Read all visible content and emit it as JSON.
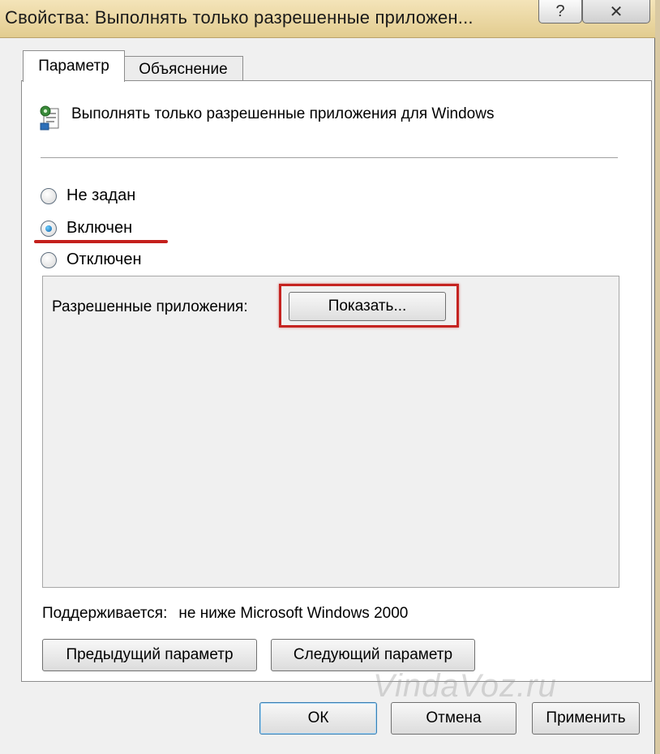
{
  "window": {
    "title": "Свойства: Выполнять только разрешенные приложен..."
  },
  "titlebar": {
    "help_label": "?",
    "close_label": "✕"
  },
  "tabs": [
    {
      "label": "Параметр",
      "active": true
    },
    {
      "label": "Объяснение",
      "active": false
    }
  ],
  "policy": {
    "title": "Выполнять только разрешенные приложения для Windows",
    "icon": "policy-settings-icon"
  },
  "radios": [
    {
      "label": "Не задан",
      "checked": false
    },
    {
      "label": "Включен",
      "checked": true
    },
    {
      "label": "Отключен",
      "checked": false
    }
  ],
  "options": {
    "allowed_label": "Разрешенные приложения:",
    "show_button": "Показать..."
  },
  "supported": {
    "label": "Поддерживается:",
    "value": "не ниже Microsoft Windows 2000"
  },
  "nav": {
    "prev_label": "Предыдущий параметр",
    "next_label": "Следующий параметр"
  },
  "footer": {
    "ok_label": "ОК",
    "cancel_label": "Отмена",
    "apply_label": "Применить"
  },
  "watermark": "VindaVoz.ru",
  "colors": {
    "highlight_red": "#c52421",
    "titlebar": "#e8d49c"
  }
}
